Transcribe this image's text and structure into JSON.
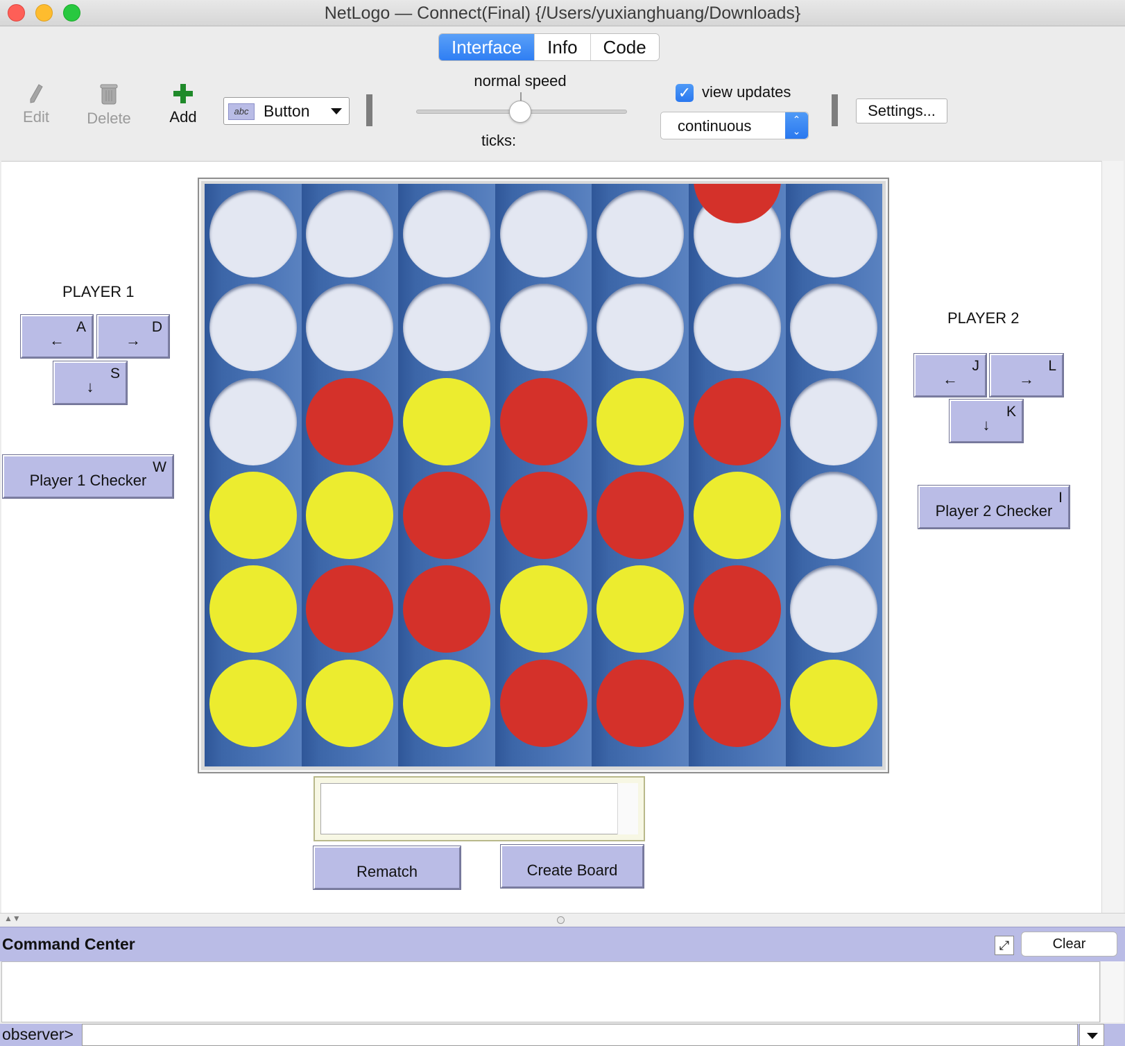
{
  "window": {
    "title": "NetLogo — Connect(Final) {/Users/yuxianghuang/Downloads}"
  },
  "tabs": [
    {
      "label": "Interface",
      "active": true
    },
    {
      "label": "Info",
      "active": false
    },
    {
      "label": "Code",
      "active": false
    }
  ],
  "toolbar": {
    "edit_label": "Edit",
    "delete_label": "Delete",
    "add_label": "Add",
    "widget_type": "Button",
    "widget_icon_text": "abc",
    "speed_label": "normal speed",
    "speed_level": 0.5,
    "ticks_label": "ticks:",
    "view_updates_label": "view updates",
    "view_updates_checked": true,
    "update_mode": "continuous",
    "settings_label": "Settings..."
  },
  "player1": {
    "label": "PLAYER 1",
    "left": {
      "arrow": "←",
      "key": "A"
    },
    "right": {
      "arrow": "→",
      "key": "D"
    },
    "down": {
      "arrow": "↓",
      "key": "S"
    },
    "checker": {
      "label": "Player 1 Checker",
      "key": "W"
    }
  },
  "player2": {
    "label": "PLAYER 2",
    "left": {
      "arrow": "←",
      "key": "J"
    },
    "right": {
      "arrow": "→",
      "key": "L"
    },
    "down": {
      "arrow": "↓",
      "key": "K"
    },
    "checker": {
      "label": "Player 2 Checker",
      "key": "I"
    }
  },
  "board": {
    "columns": 7,
    "rows": 6,
    "colors": {
      "red": "#d4312a",
      "yellow": "#ecec2f",
      "empty": "#e3e7f2",
      "board": "#3c66a8"
    },
    "grid": [
      [
        "empty",
        "empty",
        "empty",
        "empty",
        "empty",
        "empty",
        "empty"
      ],
      [
        "empty",
        "empty",
        "empty",
        "empty",
        "empty",
        "empty",
        "empty"
      ],
      [
        "empty",
        "red",
        "yellow",
        "red",
        "yellow",
        "red",
        "empty"
      ],
      [
        "yellow",
        "yellow",
        "red",
        "red",
        "red",
        "yellow",
        "empty"
      ],
      [
        "yellow",
        "red",
        "red",
        "yellow",
        "yellow",
        "red",
        "empty"
      ],
      [
        "yellow",
        "yellow",
        "yellow",
        "red",
        "red",
        "red",
        "yellow"
      ]
    ],
    "pending_checker": {
      "column": 5,
      "color": "red"
    }
  },
  "monitor": {
    "value": ""
  },
  "buttons": {
    "rematch": "Rematch",
    "create_board": "Create Board"
  },
  "command_center": {
    "title": "Command Center",
    "clear_label": "Clear",
    "prompt": "observer>",
    "input_value": ""
  }
}
